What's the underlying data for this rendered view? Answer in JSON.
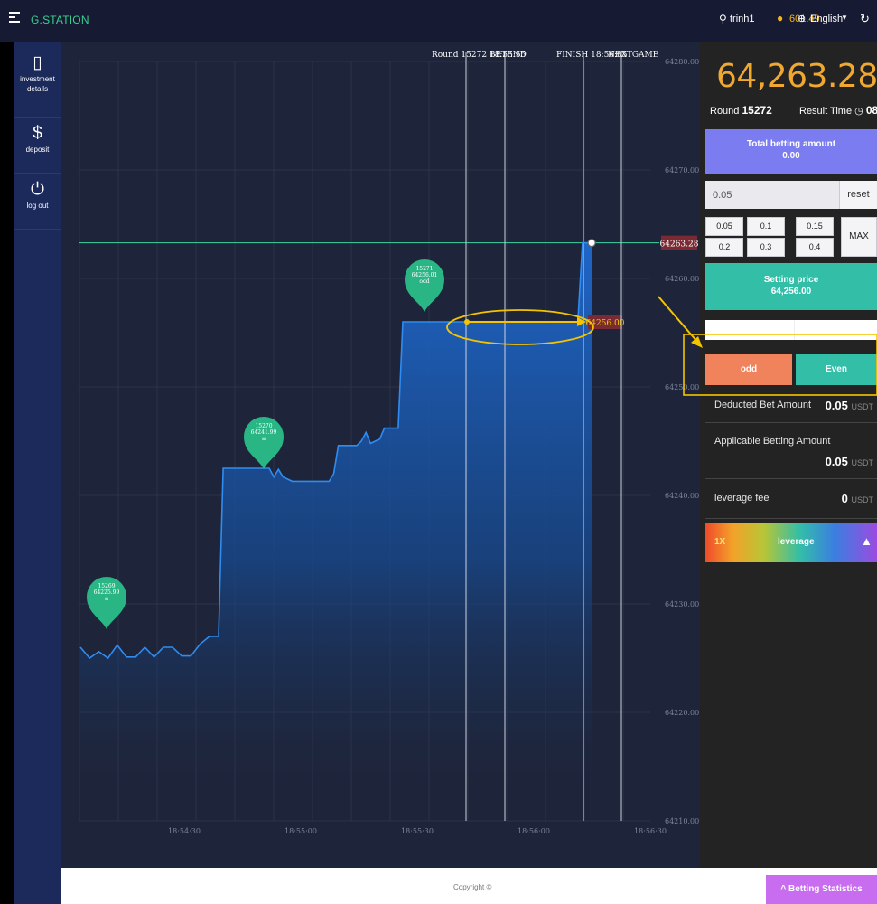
{
  "header": {
    "brand": "G.STATION",
    "username": "trinh1",
    "balance": "601.49",
    "language": "English"
  },
  "icons": {
    "menu": "menu-icon",
    "user": "user-icon",
    "coin": "coin-icon",
    "globe": "globe-icon",
    "refresh": "refresh-icon",
    "clipboard": "clipboard-icon",
    "dollar": "dollar-icon",
    "power": "power-icon",
    "warning": "warning-icon"
  },
  "sidebar": {
    "items": [
      {
        "label": "investment details",
        "icon": "clipboard-icon"
      },
      {
        "label": "deposit",
        "icon": "dollar-icon"
      },
      {
        "label": "log out",
        "icon": "power-icon"
      }
    ]
  },
  "chart": {
    "vline_labels": [
      {
        "text": "Round 15272  18:55:55",
        "label2": "BETEND"
      },
      {
        "text": "FINISH 18:56:05",
        "label2": "NEXTGAME"
      }
    ],
    "current_price_tag": "64263.28",
    "setting_price_tag": "64256.00"
  },
  "chart_data": {
    "type": "line",
    "x_ticks": [
      "18:54:30",
      "18:55:00",
      "18:55:30",
      "18:56:00",
      "18:56:30"
    ],
    "y_ticks": [
      "64280.00",
      "64270.00",
      "64260.00",
      "64250.00",
      "64240.00",
      "64230.00",
      "64220.00",
      "64210.00"
    ],
    "ylim": [
      64210,
      64280
    ],
    "grid": true,
    "series": [
      {
        "values": [
          [
            0,
            64226.0
          ],
          [
            2,
            64225.0
          ],
          [
            4,
            64225.6
          ],
          [
            6,
            64225.0
          ],
          [
            8,
            64226.2
          ],
          [
            10,
            64225.1
          ],
          [
            12,
            64225.1
          ],
          [
            14,
            64226.0
          ],
          [
            16,
            64225.1
          ],
          [
            18,
            64226.0
          ],
          [
            20,
            64226.0
          ],
          [
            22,
            64225.2
          ],
          [
            24,
            64225.2
          ],
          [
            26,
            64226.3
          ],
          [
            28,
            64227.0
          ],
          [
            30,
            64227.0
          ],
          [
            31,
            64242.5
          ],
          [
            41,
            64242.5
          ],
          [
            42,
            64241.7
          ],
          [
            43,
            64242.4
          ],
          [
            44,
            64241.7
          ],
          [
            46,
            64241.3
          ],
          [
            54,
            64241.3
          ],
          [
            55,
            64242.0
          ],
          [
            56,
            64244.6
          ],
          [
            60,
            64244.6
          ],
          [
            61,
            64245.0
          ],
          [
            62,
            64245.8
          ],
          [
            63,
            64244.8
          ],
          [
            65,
            64245.2
          ],
          [
            66,
            64246.2
          ],
          [
            69,
            64246.2
          ],
          [
            70,
            64256.0
          ],
          [
            104,
            64256.0
          ],
          [
            108,
            64256.0
          ],
          [
            109,
            64263.28
          ],
          [
            111,
            64263.28
          ]
        ]
      }
    ],
    "annotations": [
      {
        "round": "15269",
        "price": "64225.99",
        "result": "≡"
      },
      {
        "round": "15270",
        "price": "64241.99",
        "result": "≡"
      },
      {
        "round": "15271",
        "price": "64256.01",
        "result": "odd"
      }
    ],
    "reference_lines": {
      "current": 64263.28,
      "setting": 64256.0
    }
  },
  "panel": {
    "current_price": "64,263.28",
    "round_label": "Round",
    "round_number": "15272",
    "result_time_label": "Result Time",
    "result_time_value": "08",
    "total_bet_label": "Total betting amount",
    "total_bet_value": "0.00",
    "amount_value": "0.05",
    "reset_label": "reset",
    "chips": [
      "0.05",
      "0.1",
      "0.15",
      "0.2",
      "0.3",
      "0.4"
    ],
    "max_label": "MAX",
    "setting_price_label": "Setting price",
    "setting_price_value": "64,256.00",
    "odd_label": "odd",
    "even_label": "Even",
    "deducted_label": "Deducted Bet Amount",
    "deducted_value": "0.05",
    "applicable_label": "Applicable Betting Amount",
    "applicable_value": "0.05",
    "fee_label": "leverage fee",
    "fee_value": "0",
    "currency": "USDT",
    "leverage_value": "1X",
    "leverage_label": "leverage"
  },
  "footer": {
    "copyright": "Copyright ©",
    "stats_label": "Betting Statistics"
  },
  "colors": {
    "accent_green": "#39d08f",
    "price_orange": "#f0a830",
    "odd": "#f0835c",
    "even": "#33bea8",
    "total_box": "#7b7cf0",
    "line": "#2f8cf0",
    "highlight": "#f5c400"
  }
}
